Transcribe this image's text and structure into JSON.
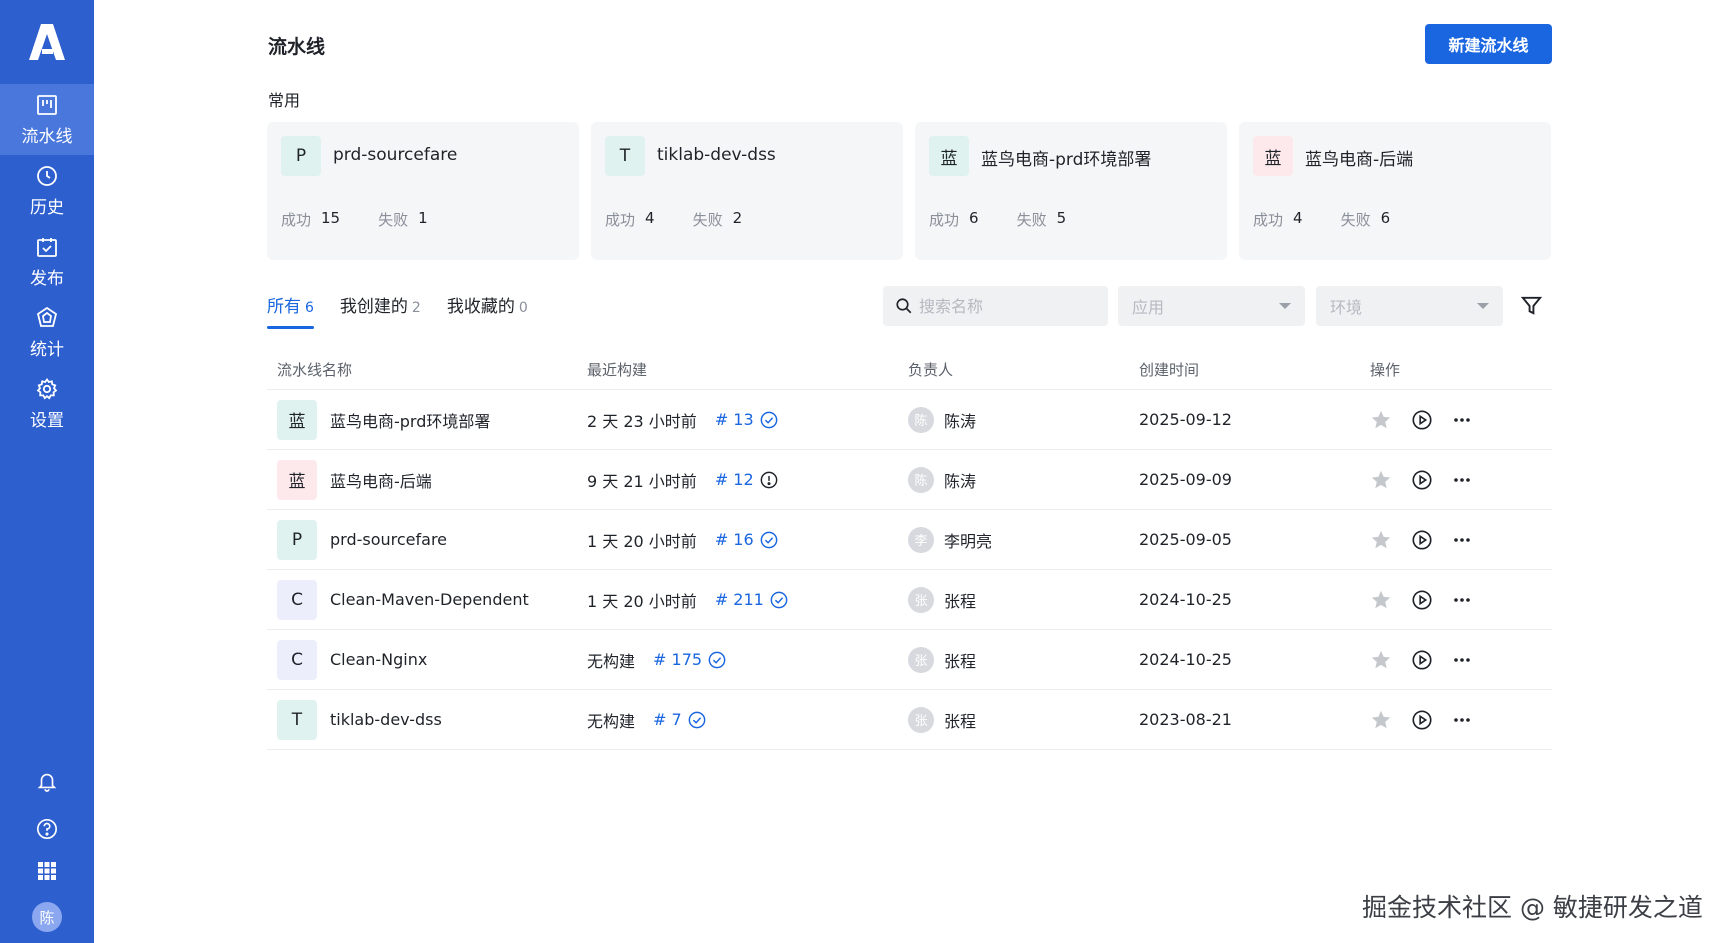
{
  "sidebar": {
    "items": [
      {
        "label": "流水线",
        "icon": "pipeline-icon"
      },
      {
        "label": "历史",
        "icon": "clock-icon"
      },
      {
        "label": "发布",
        "icon": "calendar-check-icon"
      },
      {
        "label": "统计",
        "icon": "stats-icon"
      },
      {
        "label": "设置",
        "icon": "gear-icon"
      }
    ],
    "avatar": "陈"
  },
  "header": {
    "title": "流水线",
    "new_button": "新建流水线"
  },
  "recent": {
    "label": "常用",
    "cards": [
      {
        "badge": "P",
        "name": "prd-sourcefare",
        "success_label": "成功",
        "success": "15",
        "fail_label": "失败",
        "fail": "1"
      },
      {
        "badge": "T",
        "name": "tiklab-dev-dss",
        "success_label": "成功",
        "success": "4",
        "fail_label": "失败",
        "fail": "2"
      },
      {
        "badge": "蓝",
        "name": "蓝鸟电商-prd环境部署",
        "success_label": "成功",
        "success": "6",
        "fail_label": "失败",
        "fail": "5"
      },
      {
        "badge": "蓝",
        "name": "蓝鸟电商-后端",
        "success_label": "成功",
        "success": "4",
        "fail_label": "失败",
        "fail": "6"
      }
    ]
  },
  "tabs": [
    {
      "label": "所有",
      "count": "6"
    },
    {
      "label": "我创建的",
      "count": "2"
    },
    {
      "label": "我收藏的",
      "count": "0"
    }
  ],
  "filters": {
    "search_placeholder": "搜索名称",
    "app_placeholder": "应用",
    "env_placeholder": "环境"
  },
  "table": {
    "headers": [
      "流水线名称",
      "最近构建",
      "负责人",
      "创建时间",
      "操作"
    ],
    "rows": [
      {
        "badge": "蓝",
        "name": "蓝鸟电商-prd环境部署",
        "last_build": "2 天 23 小时前",
        "build_no": "# 13",
        "status": "success",
        "owner_avatar": "陈",
        "owner": "陈涛",
        "created": "2025-09-12"
      },
      {
        "badge": "蓝",
        "name": "蓝鸟电商-后端",
        "last_build": "9 天 21 小时前",
        "build_no": "# 12",
        "status": "failed",
        "owner_avatar": "陈",
        "owner": "陈涛",
        "created": "2025-09-09"
      },
      {
        "badge": "P",
        "name": "prd-sourcefare",
        "last_build": "1 天 20 小时前",
        "build_no": "# 16",
        "status": "success",
        "owner_avatar": "李",
        "owner": "李明亮",
        "created": "2025-09-05"
      },
      {
        "badge": "C",
        "name": "Clean-Maven-Dependent",
        "last_build": "1 天 20 小时前",
        "build_no": "# 211",
        "status": "success",
        "owner_avatar": "张",
        "owner": "张程",
        "created": "2024-10-25"
      },
      {
        "badge": "C",
        "name": "Clean-Nginx",
        "last_build": "无构建",
        "build_no": "# 175",
        "status": "success",
        "owner_avatar": "张",
        "owner": "张程",
        "created": "2024-10-25"
      },
      {
        "badge": "T",
        "name": "tiklab-dev-dss",
        "last_build": "无构建",
        "build_no": "# 7",
        "status": "success",
        "owner_avatar": "张",
        "owner": "张程",
        "created": "2023-08-21"
      }
    ]
  },
  "colors": {
    "sidebar": "#2d5fcf",
    "accent": "#1a66e0",
    "badge_green": "#dff2ef",
    "badge_pink": "#fde9ec",
    "badge_purple": "#eceefb"
  },
  "watermark": "掘金技术社区 @ 敏捷研发之道"
}
